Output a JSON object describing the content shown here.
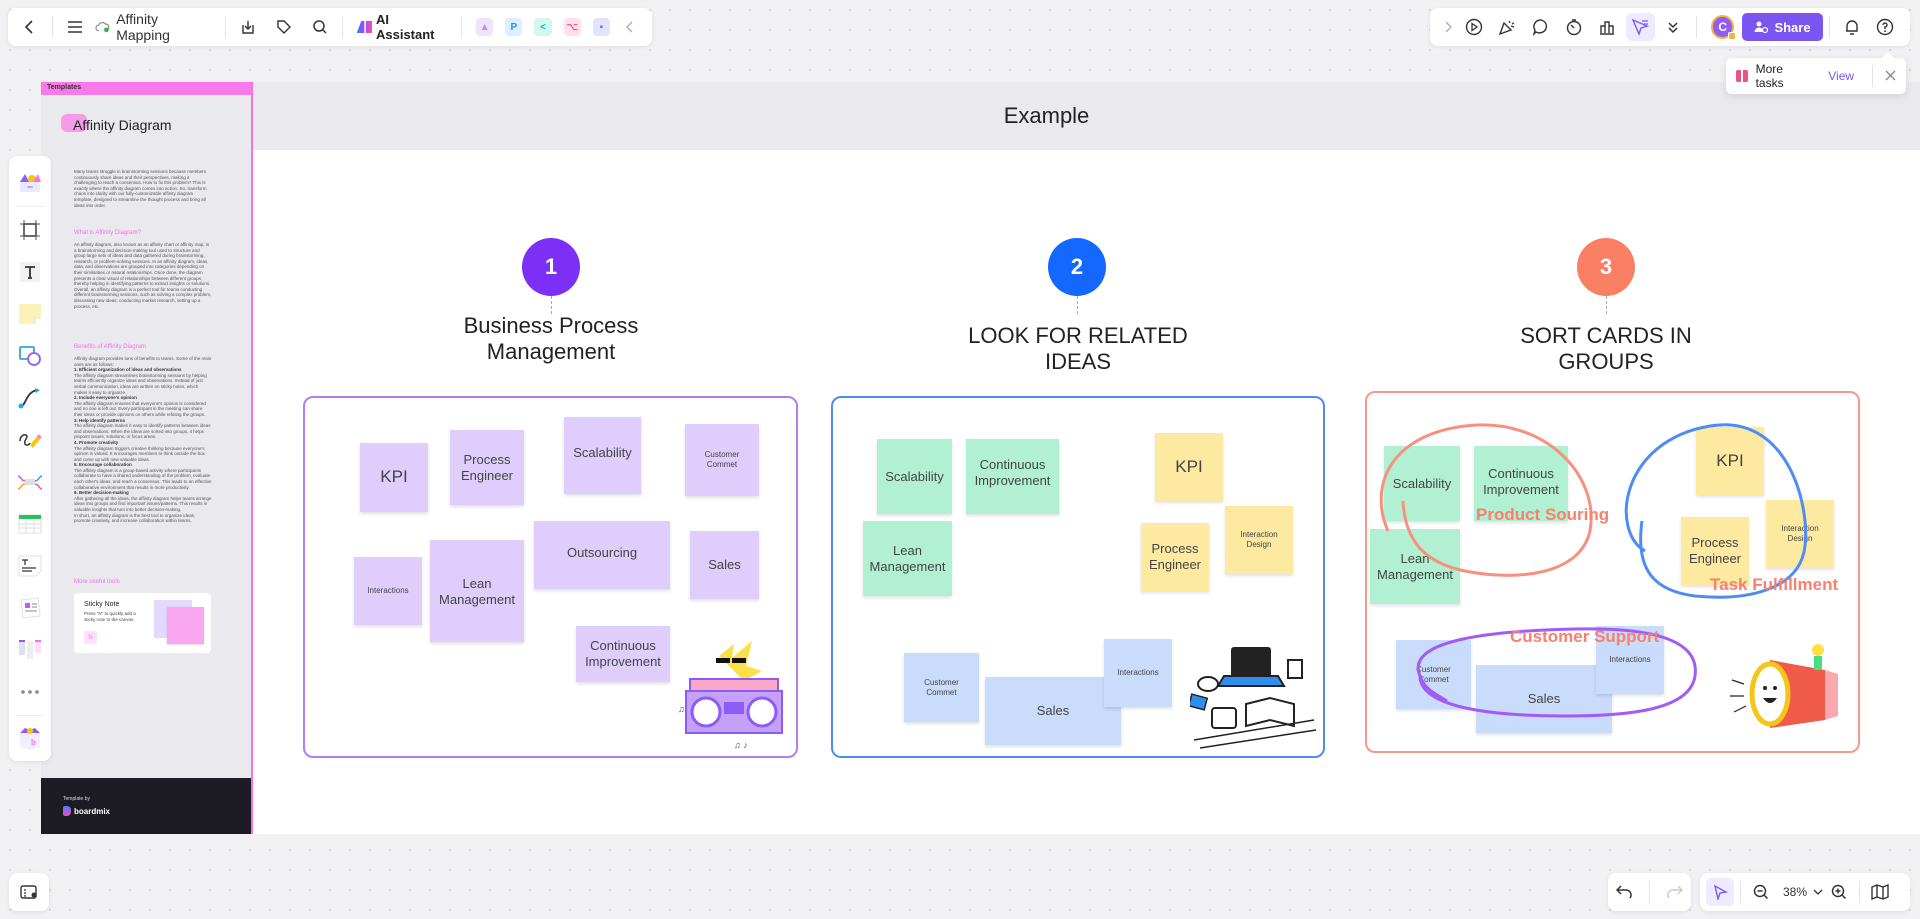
{
  "toolbar_left": {
    "back_icon": "chevron-left-icon",
    "menu_icon": "hamburger-icon",
    "doc_title": "Affinity Mapping",
    "save_status_icon": "cloud-synced-icon",
    "export_icon": "download-icon",
    "tag_icon": "tag-icon",
    "search_icon": "search-icon",
    "ai_assistant_label": "AI Assistant",
    "apps": [
      {
        "name": "ai-image-icon",
        "color": "#b792f5",
        "glyph": "▲"
      },
      {
        "name": "p-app-icon",
        "color": "#2d8cf0",
        "glyph": "P"
      },
      {
        "name": "mindmap-app-icon",
        "color": "#13c2b3",
        "glyph": "<"
      },
      {
        "name": "flow-app-icon",
        "color": "#f05a8c",
        "glyph": "⌥"
      },
      {
        "name": "chat-app-icon",
        "color": "#6a6af4",
        "glyph": "▪"
      }
    ],
    "collapse_icon": "chevron-left-icon"
  },
  "toolbar_right": {
    "expand_icon": "chevron-right-icon",
    "tools": [
      {
        "name": "present-icon",
        "glyph": "▷"
      },
      {
        "name": "celebrate-icon",
        "glyph": "✺"
      },
      {
        "name": "comment-icon",
        "glyph": "◯"
      },
      {
        "name": "timer-icon",
        "glyph": "◔"
      },
      {
        "name": "vote-icon",
        "glyph": "▥"
      },
      {
        "name": "follow-cursor-icon",
        "glyph": "➤",
        "active": true
      },
      {
        "name": "more-icon",
        "glyph": "⌄"
      }
    ],
    "avatar_initial": "C",
    "share_label": "Share",
    "notification_icon": "bell-icon",
    "help_icon": "help-icon"
  },
  "tasks_popup": {
    "label": "More tasks",
    "view_label": "View"
  },
  "tool_rail": [
    "templates-icon",
    "frame-icon",
    "text-icon",
    "sticky-note-icon",
    "shape-icon",
    "connector-icon",
    "pen-icon",
    "mindmap-icon",
    "table-icon",
    "text-doc-icon",
    "card-icon",
    "kanban-icon",
    "more-tools-icon",
    "plugins-icon"
  ],
  "template_panel": {
    "header": "Templates",
    "title": "Affinity Diagram",
    "intro": "Many teams struggle in brainstorming sessions because members continuously share ideas and their perspectives, making it challenging to reach a consensus. How to fix this problem? This is exactly where the affinity diagram comes into action. So, transform chaos into clarity with our fully-customizable affinity diagram template, designed to streamline the thought process and bring all ideas into order.",
    "what_heading": "What is Affinity Diagram?",
    "what_text": "An affinity diagram, also known as an affinity chart or affinity map, is a brainstorming and decision-making tool used to structure and group large sets of ideas and data gathered during brainstorming, research, or problem-solving sessions. In an affinity diagram, ideas, data, and observations are grouped into categories depending on their similarities or natural relationships. Once done, the diagram presents a clear visual of relationships between different groups, thereby helping in identifying patterns to extract insights or solutions. Overall, an affinity diagram is a perfect tool for teams conducting different brainstorming sessions, such as solving a complex problem, discussing new ideas, conducting market research, setting up a process, etc.",
    "benefits_heading": "Benefits of Affinity Diagram",
    "benefits_intro": "Affinity diagram provides tons of benefits to teams. Some of the main ones are as follows:",
    "benefits": [
      {
        "title": "1. Efficient organization of ideas and observations",
        "text": "The affinity diagram streamlines brainstorming sessions by helping teams efficiently organize ideas and observations. Instead of just verbal communication, ideas are written on sticky notes, which makes it easy to organize."
      },
      {
        "title": "2. Include everyone's opinion",
        "text": "The affinity diagram ensures that everyone's opinion is considered and no one is left out. Every participant in the meeting can share their ideas or provide opinions on others while refining the groups."
      },
      {
        "title": "3. Help identify patterns",
        "text": "The affinity diagram makes it easy to identify patterns between ideas and observations. When the ideas are sorted into groups, it helps pinpoint issues, solutions, or focus areas."
      },
      {
        "title": "4. Promote creativity",
        "text": "The affinity diagram triggers creative thinking because everyone's opinion is valued. It encourages members to think outside the box and come up with new valuable ideas."
      },
      {
        "title": "5. Encourage collaboration",
        "text": "The affinity diagram is a group-based activity where participants collaborate to have a shared understanding of the problem, evaluate each other's ideas, and reach a consensus. This leads to an effective collaborative environment that results in more productivity."
      },
      {
        "title": "6. Better decision-making",
        "text": "After gathering all the ideas, the affinity diagram helps teams arrange ideas into groups and find important issues/patterns. This results in valuable insights that turn into better decision-making."
      }
    ],
    "benefits_outro": "In short, an affinity diagram is the best tool to organize ideas, promote creativity, and increase collaboration within teams.",
    "tools_heading": "More useful tools",
    "tool_card": {
      "title": "Sticky Note",
      "desc": "Press \"N\" to quickly add a sticky note to the canvas.",
      "key": "N"
    },
    "footer_by": "Template by",
    "footer_brand": "boardmix"
  },
  "example_header": "Example",
  "steps": [
    {
      "number": "1",
      "title": "Business Process Management",
      "color": "#7c2ff5",
      "border": "#b57bf5"
    },
    {
      "number": "2",
      "title": "LOOK FOR RELATED IDEAS",
      "color": "#1467ff",
      "border": "#4d8cf5"
    },
    {
      "number": "3",
      "title": "SORT CARDS IN GROUPS",
      "color": "#fa7f65",
      "border": "#f59a8a"
    }
  ],
  "group1_notes": [
    "KPI",
    "Process Engineer",
    "Scalability",
    "Customer Commet",
    "Interactions",
    "Lean Management",
    "Outsourcing",
    "Sales",
    "Continuous Improvement"
  ],
  "group2_notes": [
    "Scalability",
    "Continuous Improvement",
    "Lean Management",
    "KPI",
    "Process Engineer",
    "Interaction Design",
    "Customer Commet",
    "Sales",
    "Interactions"
  ],
  "group3_notes": [
    "Scalability",
    "Continuous Improvement",
    "Lean Management",
    "KPI",
    "Process Engineer",
    "Interaction Design",
    "Customer Commet",
    "Sales",
    "Interactions"
  ],
  "group3_annotations": [
    "Product Souring",
    "Task Fulfillment",
    "Customer Support"
  ],
  "bottom": {
    "outline_icon": "outline-panel-icon",
    "undo_icon": "undo-icon",
    "redo_icon": "redo-icon",
    "select_icon": "pointer-icon",
    "zoom_out_icon": "zoom-out-icon",
    "zoom_level": "38%",
    "zoom_in_icon": "zoom-in-icon",
    "map_icon": "minimap-icon"
  }
}
